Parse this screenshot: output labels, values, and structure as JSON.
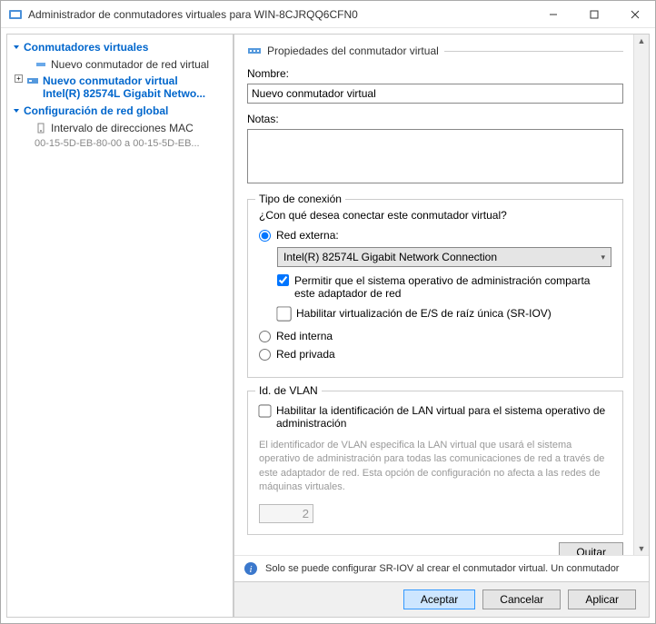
{
  "window": {
    "title": "Administrador de conmutadores virtuales para WIN-8CJRQQ6CFN0"
  },
  "sidebar": {
    "categories": [
      {
        "label": "Conmutadores virtuales",
        "items": [
          {
            "label": "Nuevo conmutador de red virtual"
          },
          {
            "label_line1": "Nuevo conmutador virtual",
            "label_line2": "Intel(R) 82574L Gigabit Netwo..."
          }
        ]
      },
      {
        "label": "Configuración de red global",
        "items": [
          {
            "label": "Intervalo de direcciones MAC",
            "sub": "00-15-5D-EB-80-00 a 00-15-5D-EB..."
          }
        ]
      }
    ]
  },
  "main": {
    "section_title": "Propiedades del conmutador virtual",
    "name_label": "Nombre:",
    "name_value": "Nuevo conmutador virtual",
    "notes_label": "Notas:",
    "connection": {
      "group_title": "Tipo de conexión",
      "prompt": "¿Con qué desea conectar este conmutador virtual?",
      "external_label": "Red externa:",
      "adapter_value": "Intel(R) 82574L Gigabit Network Connection",
      "share_label": "Permitir que el sistema operativo de administración comparta este adaptador de red",
      "sriov_label": "Habilitar virtualización de E/S de raíz única (SR-IOV)",
      "internal_label": "Red interna",
      "private_label": "Red privada"
    },
    "vlan": {
      "group_title": "Id. de VLAN",
      "enable_label": "Habilitar la identificación de LAN virtual para el sistema operativo de administración",
      "help": "El identificador de VLAN especifica la LAN virtual que usará el sistema operativo de administración para todas las comunicaciones de red a través de este adaptador de red. Esta opción de configuración no afecta a las redes de máquinas virtuales.",
      "id_value": "2"
    },
    "remove_btn": "Quitar",
    "info_text": "Solo se puede configurar SR-IOV al crear el conmutador virtual. Un conmutador"
  },
  "buttons": {
    "ok": "Aceptar",
    "cancel": "Cancelar",
    "apply": "Aplicar"
  }
}
